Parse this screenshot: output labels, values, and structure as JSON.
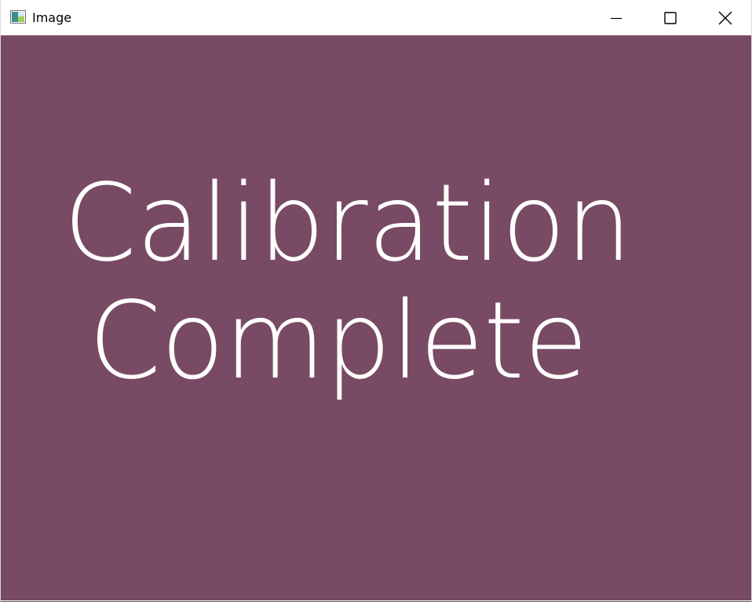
{
  "window": {
    "title": "Image",
    "controls": {
      "minimize": "minimize",
      "maximize": "maximize",
      "close": "close"
    }
  },
  "canvas": {
    "background": "#784a63",
    "text_color": "#ffffff",
    "lines": [
      "Calibration",
      "Complete"
    ]
  }
}
